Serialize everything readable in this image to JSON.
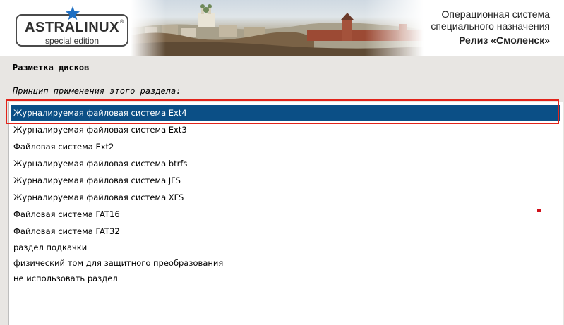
{
  "header": {
    "logo_main": "ASTRALINUX",
    "logo_reg": "®",
    "logo_sub": "special edition",
    "line1": "Операционная система",
    "line2": "специального назначения",
    "line3": "Релиз «Смоленск»"
  },
  "page": {
    "title": "Разметка дисков",
    "prompt": "Принцип применения этого раздела:"
  },
  "options": [
    "Журналируемая файловая система Ext4",
    "Журналируемая файловая система Ext3",
    "Файловая система Ext2",
    "Журналируемая файловая система btrfs",
    "Журналируемая файловая система JFS",
    "Журналируемая файловая система XFS",
    "Файловая система FAT16",
    "Файловая система FAT32",
    "раздел подкачки",
    "физический том для защитного преобразования",
    "не использовать раздел"
  ],
  "selected_index": 0,
  "colors": {
    "selection": "#0b4f86",
    "highlight_border": "#e2231a",
    "logo_star": "#1d6fc4"
  }
}
